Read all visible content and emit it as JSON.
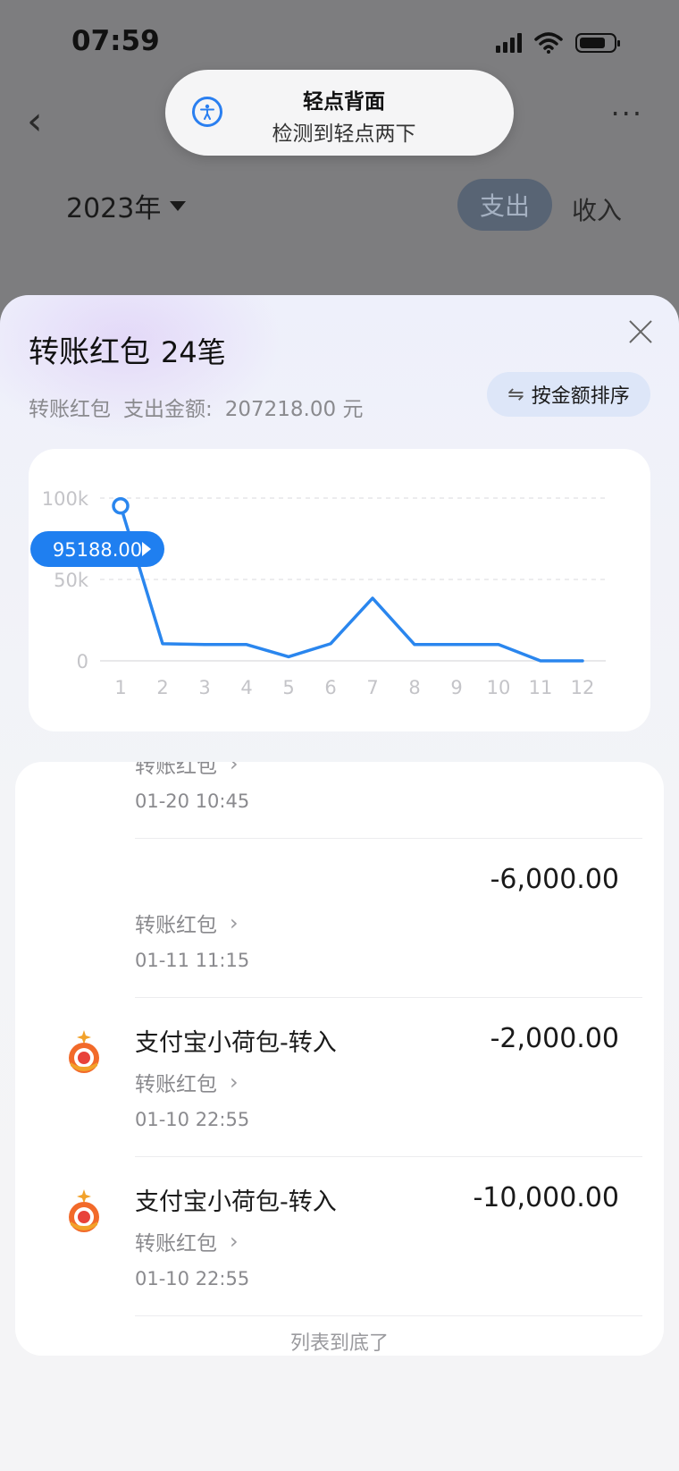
{
  "status": {
    "time": "07:59"
  },
  "nav": {
    "back": "‹",
    "more": "···"
  },
  "toast": {
    "title": "轻点背面",
    "subtitle": "检测到轻点两下"
  },
  "filter": {
    "year": "2023年",
    "tabs": {
      "expense": "支出",
      "income": "收入"
    }
  },
  "sheet": {
    "title": "转账红包",
    "count": "24笔",
    "summary_category": "转账红包",
    "summary_label": "支出金额:",
    "summary_amount": "207218.00 元",
    "sort_label": "按金额排序",
    "sort_icon": "⇋"
  },
  "chart_data": {
    "type": "line",
    "x": [
      "1",
      "2",
      "3",
      "4",
      "5",
      "6",
      "7",
      "8",
      "9",
      "10",
      "11",
      "12"
    ],
    "series": [
      {
        "values": [
          95188,
          10500,
          10000,
          10000,
          2500,
          10500,
          38500,
          10000,
          10000,
          10000,
          0,
          0
        ]
      }
    ],
    "yticks": [
      "100k",
      "50k",
      "0"
    ],
    "ylim": [
      0,
      100000
    ],
    "tooltip": "95188.00",
    "grid": true,
    "color": "#2a86ee"
  },
  "transactions": [
    {
      "title": "",
      "amount": "",
      "category": "转账红包",
      "time": "01-20 10:45",
      "logo": false
    },
    {
      "title": "",
      "amount": "-6,000.00",
      "category": "转账红包",
      "time": "01-11 11:15",
      "logo": false
    },
    {
      "title": "支付宝小荷包-转入",
      "amount": "-2,000.00",
      "category": "转账红包",
      "time": "01-10 22:55",
      "logo": true
    },
    {
      "title": "支付宝小荷包-转入",
      "amount": "-10,000.00",
      "category": "转账红包",
      "time": "01-10 22:55",
      "logo": true
    }
  ],
  "list_end": "列表到底了"
}
